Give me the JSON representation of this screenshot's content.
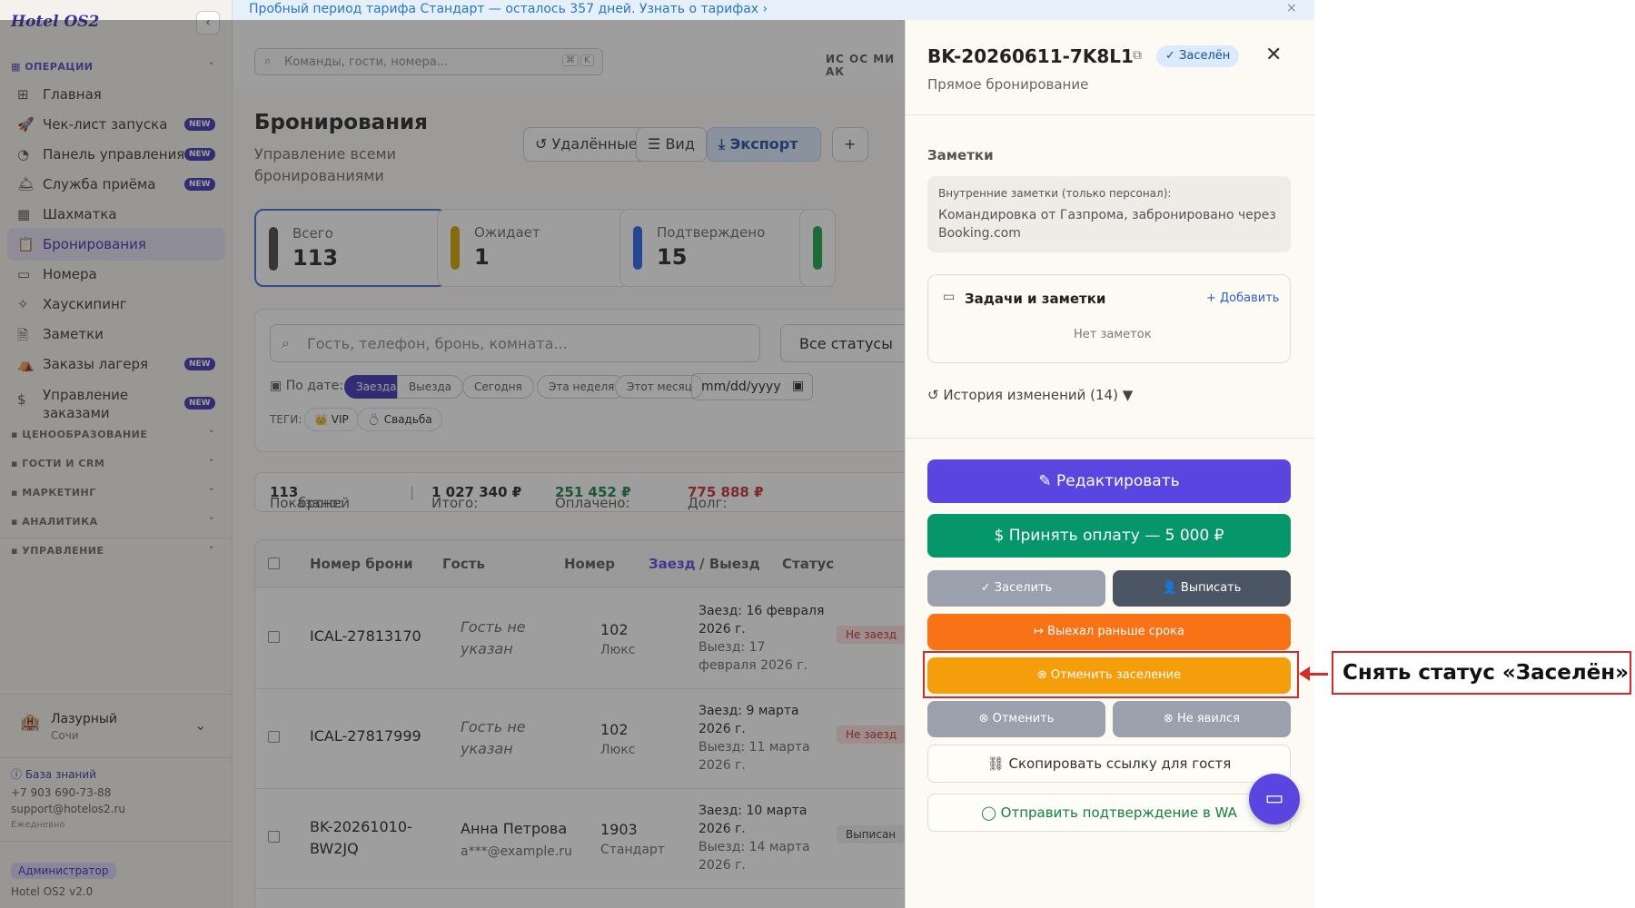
{
  "app": {
    "logo": "Hotel OS2"
  },
  "banner": {
    "text": "Пробный период тарифа Стандарт — осталось 357 дней. Узнать о тарифах ›"
  },
  "topbar": {
    "search_placeholder": "Команды, гости, номера...",
    "kbd1": "⌘",
    "kbd2": "K",
    "avatars": "ИС ОС МИ АК"
  },
  "sidebar": {
    "section_ops": "ОПЕРАЦИИ",
    "items": [
      {
        "label": "Главная",
        "icon": "⊞"
      },
      {
        "label": "Чек-лист запуска",
        "icon": "🚀",
        "badge": "NEW"
      },
      {
        "label": "Панель управления",
        "icon": "◔",
        "badge": "NEW"
      },
      {
        "label": "Служба приёма",
        "icon": "🛎",
        "badge": "NEW"
      },
      {
        "label": "Шахматка",
        "icon": "▦"
      },
      {
        "label": "Бронирования",
        "icon": "📋",
        "active": true
      },
      {
        "label": "Номера",
        "icon": "▭"
      },
      {
        "label": "Хаускипинг",
        "icon": "✧"
      },
      {
        "label": "Заметки",
        "icon": "🗎"
      },
      {
        "label": "Заказы лагеря",
        "icon": "⛺",
        "badge": "NEW"
      },
      {
        "label": "Управление заказами",
        "icon": "$",
        "badge": "NEW"
      }
    ],
    "sections": [
      "ЦЕНООБРАЗОВАНИЕ",
      "ГОСТИ И CRM",
      "МАРКЕТИНГ",
      "АНАЛИТИКА",
      "УПРАВЛЕНИЕ"
    ],
    "hotel": {
      "name": "Лазурный",
      "city": "Сочи"
    },
    "kb": "База знаний",
    "phone": "+7 903 690-73-88",
    "email": "support@hotelos2.ru",
    "schedule": "Ежедневно",
    "role": "Администратор",
    "version": "Hotel OS2 v2.0"
  },
  "page": {
    "title": "Бронирования",
    "subtitle": "Управление всеми бронированиями",
    "btn_deleted": "Удалённые",
    "btn_view": "Вид",
    "btn_export": "Экспорт",
    "stats": [
      {
        "label": "Всего",
        "value": "113",
        "color": "#444"
      },
      {
        "label": "Ожидает",
        "value": "1",
        "color": "#d4a000"
      },
      {
        "label": "Подтверждено",
        "value": "15",
        "color": "#2563eb"
      }
    ],
    "filters": {
      "search_placeholder": "Гость, телефон, бронь, комната...",
      "status": "Все статусы",
      "by_date": "По дате:",
      "pills": [
        "Заезда",
        "Выезда",
        "Сегодня",
        "Эта неделя",
        "Этот месяц"
      ],
      "date_placeholder": "mm/dd/yyyy",
      "tags_label": "ТЕГИ:",
      "tags": [
        "👑 VIP",
        "💍 Свадьба"
      ]
    },
    "summary": {
      "shown_label": "Показано:",
      "shown": "113",
      "shown_unit": "броней",
      "total_label": "Итого:",
      "total": "1 027 340 ₽",
      "paid_label": "Оплачено:",
      "paid": "251 452 ₽",
      "debt_label": "Долг:",
      "debt": "775 888 ₽"
    },
    "table": {
      "headers": [
        "Номер брони",
        "Гость",
        "Номер",
        "Заезд",
        "/ Выезд",
        "Статус"
      ],
      "rows": [
        {
          "num": "ICAL-27813170",
          "guest": "Гость не указан",
          "room": "102",
          "type": "Люкс",
          "in": "Заезд: 16 февраля 2026 г.",
          "out": "Выезд: 17 февраля 2026 г.",
          "status": "Не заезд"
        },
        {
          "num": "ICAL-27817999",
          "guest": "Гость не указан",
          "room": "102",
          "type": "Люкс",
          "in": "Заезд: 9 марта 2026 г.",
          "out": "Выезд: 11 марта 2026 г.",
          "status": "Не заезд"
        },
        {
          "num": "BK-20261010-BW2JQ",
          "guest": "Анна Петрова",
          "email": "a***@example.ru",
          "room": "1903",
          "type": "Стандарт",
          "in": "Заезд: 10 марта 2026 г.",
          "out": "Выезд: 14 марта 2026 г.",
          "status": "Выписан"
        }
      ]
    }
  },
  "panel": {
    "booking_id": "BK-20260611-7K8L1",
    "status": "Заселён",
    "source": "Прямое бронирование",
    "notes_title": "Заметки",
    "notes_label": "Внутренние заметки (только персонал):",
    "notes_text": "Командировка от Газпрома, забронировано через Booking.com",
    "tasks_title": "Задачи и заметки",
    "tasks_add": "+ Добавить",
    "tasks_empty": "Нет заметок",
    "history": "История изменений (14) ▼",
    "btn_edit": "Редактировать",
    "btn_pay": "Принять оплату — 5 000 ₽",
    "btn_checkin": "Заселить",
    "btn_checkout": "Выписать",
    "btn_early": "Выехал раньше срока",
    "btn_undo_checkin": "Отменить заселение",
    "btn_cancel": "Отменить",
    "btn_noshow": "Не явился",
    "btn_copy_link": "Скопировать ссылку для гостя",
    "btn_wa": "Отправить подтверждение в WA"
  },
  "annotation": {
    "callout": "Снять статус «Заселён»"
  }
}
